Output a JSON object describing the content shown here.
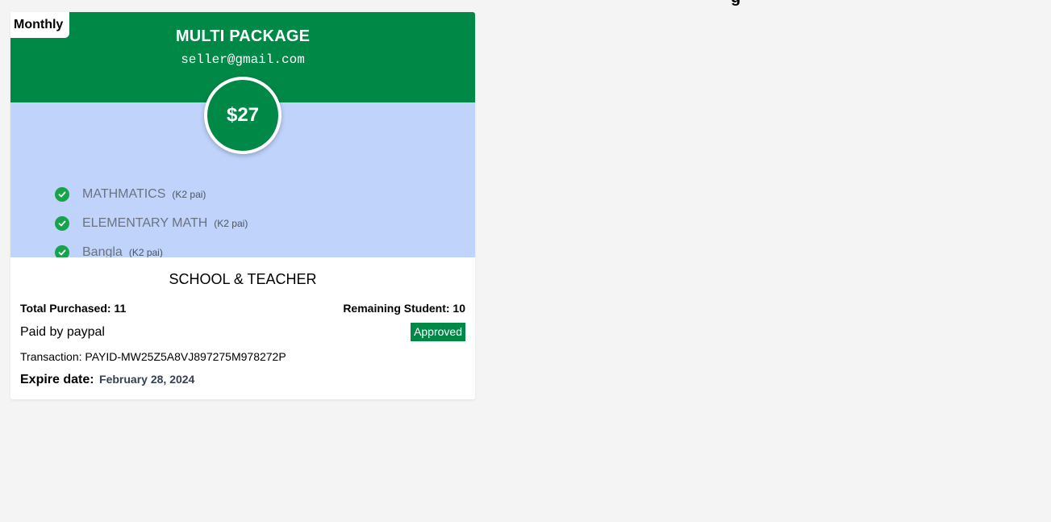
{
  "colors": {
    "brand_green": "#008847",
    "features_bg": "#bfd3fb",
    "check_green": "#16a34a",
    "page_bg": "#f4f4f4"
  },
  "page_top_fragment": "g",
  "package": {
    "period": "Monthly",
    "title": "MULTI PACKAGE",
    "email": "seller@gmail.com",
    "price": "$27",
    "features": [
      {
        "name": "MATHMATICS",
        "note": "(K2 pai)",
        "icon": "check-circle-icon"
      },
      {
        "name": "ELEMENTARY MATH",
        "note": "(K2 pai)",
        "icon": "check-circle-icon"
      },
      {
        "name": "Bangla",
        "note": "(K2 pai)",
        "icon": "check-circle-icon"
      }
    ],
    "category": "SCHOOL & TEACHER",
    "total_purchased": "Total Purchased: 11",
    "remaining_student": "Remaining Student: 10",
    "paid_by": "Paid by paypal",
    "status": "Approved",
    "transaction": "Transaction: PAYID-MW25Z5A8VJ897275M978272P",
    "expire_label": "Expire date:",
    "expire_date": "February 28, 2024"
  }
}
